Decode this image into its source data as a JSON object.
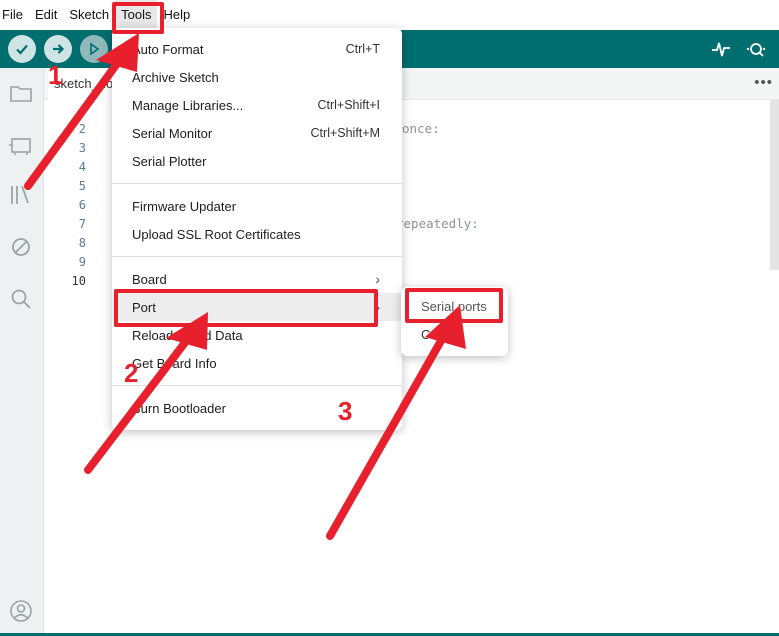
{
  "menubar": {
    "items": [
      {
        "label": "File"
      },
      {
        "label": "Edit"
      },
      {
        "label": "Sketch"
      },
      {
        "label": "Tools"
      },
      {
        "label": "Help"
      }
    ]
  },
  "toolbar": {
    "verify_icon": "check-icon",
    "upload_icon": "arrow-right-icon",
    "debug_icon": "debug-icon",
    "serial_plotter_icon": "pulse-icon",
    "serial_monitor_icon": "magnifier-icon"
  },
  "tab": {
    "label": "sketch_nov"
  },
  "editor": {
    "line_numbers": [
      "2",
      "3",
      "4",
      "5",
      "6",
      "7",
      "8",
      "9",
      "10"
    ],
    "fragment_1": "once:",
    "fragment_2": "repeatedly:"
  },
  "tools_menu": {
    "items": [
      {
        "label": "Auto Format",
        "shortcut": "Ctrl+T"
      },
      {
        "label": "Archive Sketch",
        "shortcut": ""
      },
      {
        "label": "Manage Libraries...",
        "shortcut": "Ctrl+Shift+I"
      },
      {
        "label": "Serial Monitor",
        "shortcut": "Ctrl+Shift+M"
      },
      {
        "label": "Serial Plotter",
        "shortcut": ""
      },
      {
        "label": "Firmware Updater",
        "shortcut": ""
      },
      {
        "label": "Upload SSL Root Certificates",
        "shortcut": ""
      },
      {
        "label": "Board",
        "shortcut": ""
      },
      {
        "label": "Port",
        "shortcut": ""
      },
      {
        "label": "Reload Board Data",
        "shortcut": ""
      },
      {
        "label": "Get Board Info",
        "shortcut": ""
      },
      {
        "label": "Burn Bootloader",
        "shortcut": ""
      }
    ]
  },
  "port_submenu": {
    "header": "Serial ports",
    "item": "COM3"
  },
  "annotations": {
    "step1": "1",
    "step2": "2",
    "step3": "3",
    "color": "#e8202e"
  },
  "colors": {
    "toolbar": "#006d6f",
    "accent": "#e8202e"
  }
}
